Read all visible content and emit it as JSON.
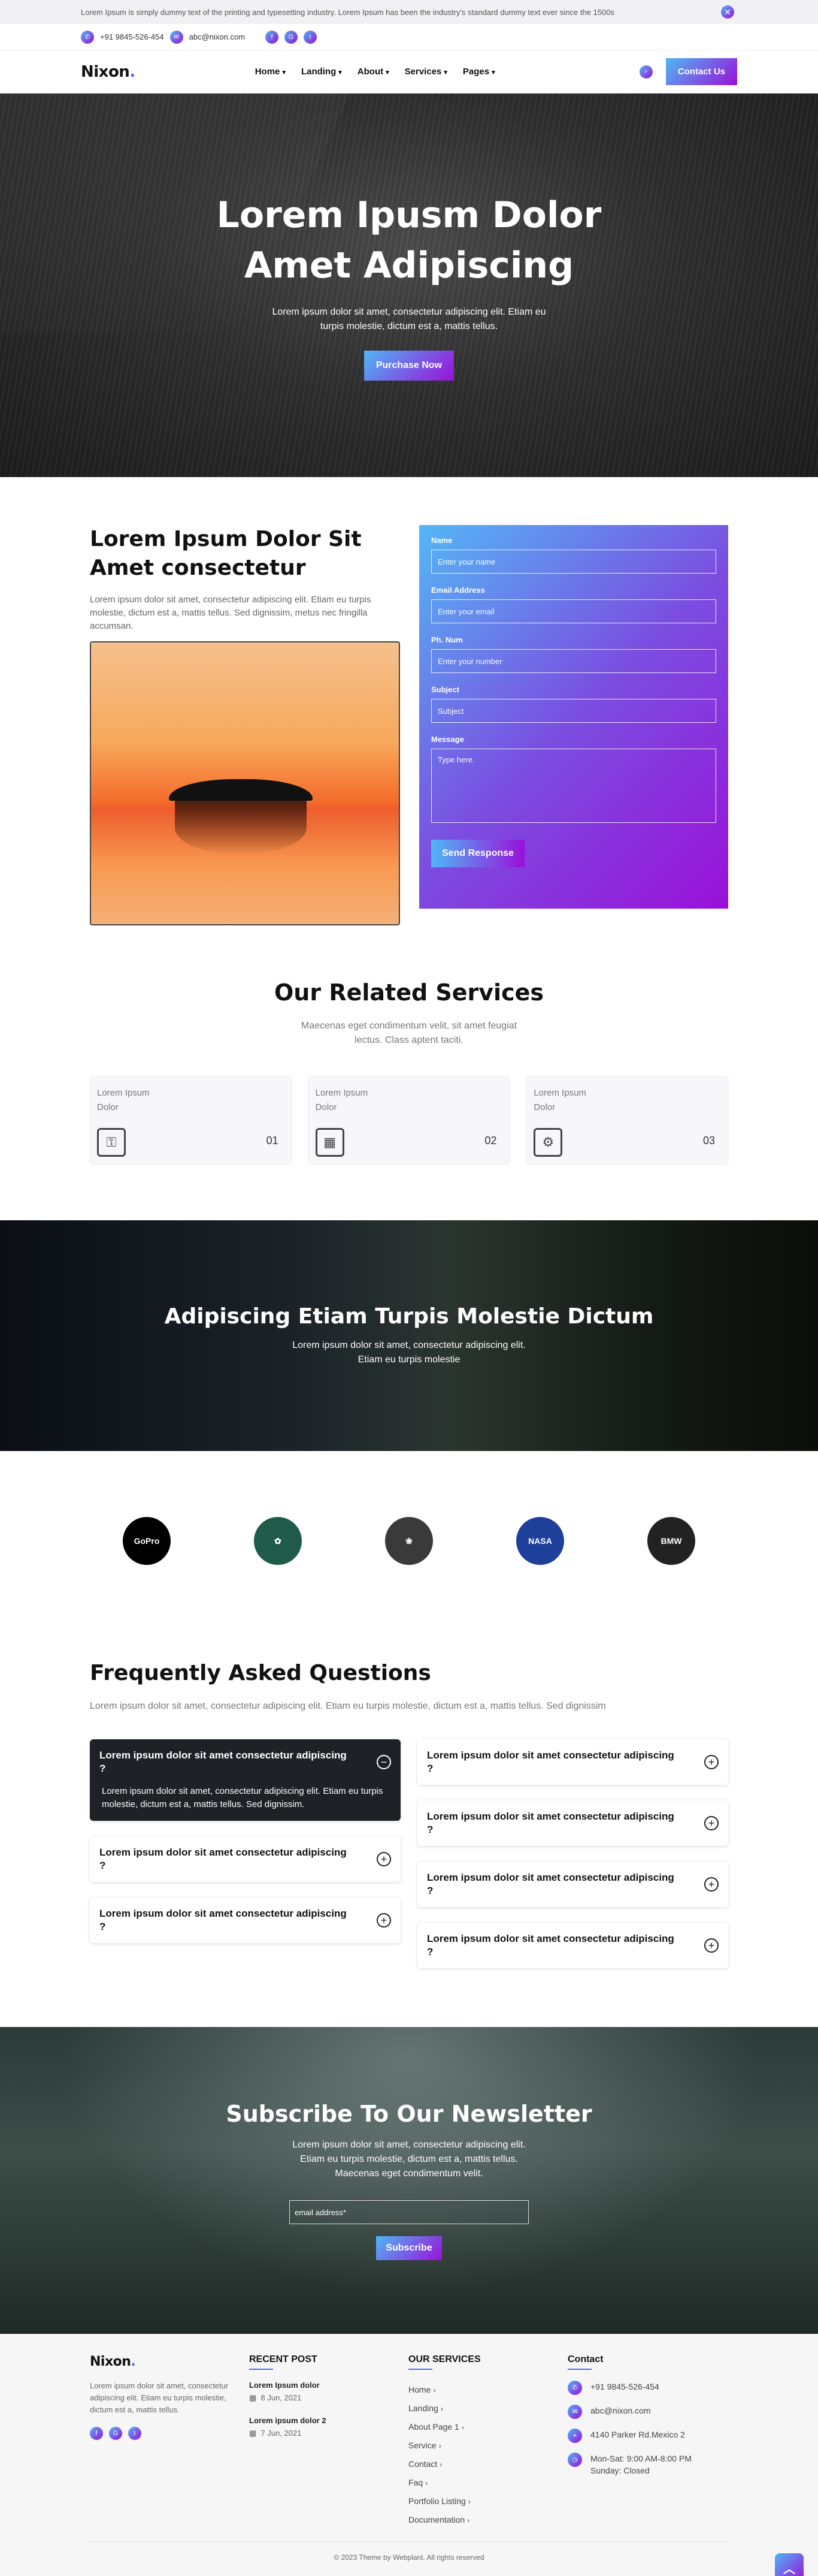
{
  "topbar": {
    "notice": "Lorem Ipsum is simply dummy text of the printing and typesetting industry. Lorem Ipsum has been the industry's standard dummy text ever since the 1500s",
    "close_icon": "✕"
  },
  "contact_bar": {
    "phone": "+91 9845-526-454",
    "email": "abc@nixon.com",
    "social": [
      "f",
      "G",
      "t"
    ]
  },
  "nav": {
    "logo": "Nixon",
    "logo_dot": ".",
    "items": [
      {
        "label": "Home"
      },
      {
        "label": "Landing"
      },
      {
        "label": "About"
      },
      {
        "label": "Services"
      },
      {
        "label": "Pages"
      }
    ],
    "dropdown_icon": "▾",
    "search_icon": "⌕",
    "cta": "Contact Us"
  },
  "hero": {
    "title": "Lorem Ipusm Dolor Amet Adipiscing",
    "text": "Lorem ipsum dolor sit amet, consectetur adipiscing elit. Etiam eu turpis molestie, dictum est a, mattis tellus.",
    "cta": "Purchase Now"
  },
  "about": {
    "title": "Lorem Ipsum Dolor Sit Amet consectetur",
    "text": "Lorem ipsum dolor sit amet, consectetur adipiscing elit. Etiam eu turpis molestie, dictum est a, mattis tellus. Sed dignissim, metus nec fringilla accumsan."
  },
  "form": {
    "name_label": "Name",
    "name_placeholder": "Enter your name",
    "email_label": "Email Address",
    "email_placeholder": "Enter your email",
    "phone_label": "Ph. Num",
    "phone_placeholder": "Enter your number",
    "subject_label": "Subject",
    "subject_placeholder": "Subject",
    "message_label": "Message",
    "message_placeholder": "Type here.",
    "submit": "Send Response"
  },
  "services": {
    "title": "Our Related Services",
    "subtitle": "Maecenas eget condimentum velit, sit amet feugiat lectus. Class aptent taciti.",
    "cards": [
      {
        "line1": "Lorem Ipsum",
        "line2": "Dolor",
        "number": "01",
        "icon": "⚿"
      },
      {
        "line1": "Lorem Ipsum",
        "line2": "Dolor",
        "number": "02",
        "icon": "▦"
      },
      {
        "line1": "Lorem Ipsum",
        "line2": "Dolor",
        "number": "03",
        "icon": "⚙"
      }
    ]
  },
  "banner": {
    "title": "Adipiscing Etiam Turpis Molestie Dictum",
    "text": "Lorem ipsum dolor sit amet, consectetur adipiscing elit. Etiam eu turpis molestie"
  },
  "brands": [
    {
      "name": "GoPro",
      "color": "#000000"
    },
    {
      "name": "✿",
      "color": "#1f5a4b"
    },
    {
      "name": "❀",
      "color": "#3a3a3a"
    },
    {
      "name": "NASA",
      "color": "#1e3f9a"
    },
    {
      "name": "BMW",
      "color": "#222222"
    }
  ],
  "faq": {
    "title": "Frequently Asked Questions",
    "subtitle": "Lorem ipsum dolor sit amet, consectetur adipiscing elit. Etiam eu turpis molestie, dictum est a, mattis tellus. Sed dignissim",
    "question": "Lorem ipsum dolor sit amet consectetur adipiscing ?",
    "answer": "Lorem ipsum dolor sit amet, consectetur adipiscing elit. Etiam eu turpis molestie, dictum est a, mattis tellus. Sed dignissim.",
    "plus": "+",
    "minus": "−"
  },
  "newsletter": {
    "title": "Subscribe To Our Newsletter",
    "text": "Lorem ipsum dolor sit amet, consectetur adipiscing elit. Etiam eu turpis molestie, dictum est a, mattis tellus. Maecenas eget condimentum velit.",
    "placeholder": "email address*",
    "button": "Subscribe"
  },
  "footer": {
    "about_text": "Lorem ipsum dolor sit amet, consectetur adipiscing elit. Etiam eu turpis molestie, dictum est a, mattis tellus.",
    "recent_title": "RECENT POST",
    "posts": [
      {
        "title": "Lorem Ipsum dolor",
        "date": "8 Jun, 2021"
      },
      {
        "title": "Lorem ipsum dolor 2",
        "date": "7 Jun, 2021"
      }
    ],
    "services_title": "OUR SERVICES",
    "links": [
      "Home",
      "Landing",
      "About Page 1",
      "Service",
      "Contact",
      "Faq",
      "Portfolio Listing",
      "Documentation"
    ],
    "contact_title": "Contact",
    "contacts": [
      {
        "icon": "✆",
        "text": "+91 9845-526-454"
      },
      {
        "icon": "✉",
        "text": "abc@nixon.com"
      },
      {
        "icon": "⌖",
        "text": "4140 Parker Rd.Mexico 2"
      },
      {
        "icon": "◷",
        "text": "Mon-Sat: 9:00 AM-8:00 PM Sunday: Closed"
      }
    ],
    "copyright": "© 2023 Theme by Webplant. All rights reserved",
    "to_top": "︿",
    "calendar_icon": "▦",
    "chevron": "›"
  }
}
